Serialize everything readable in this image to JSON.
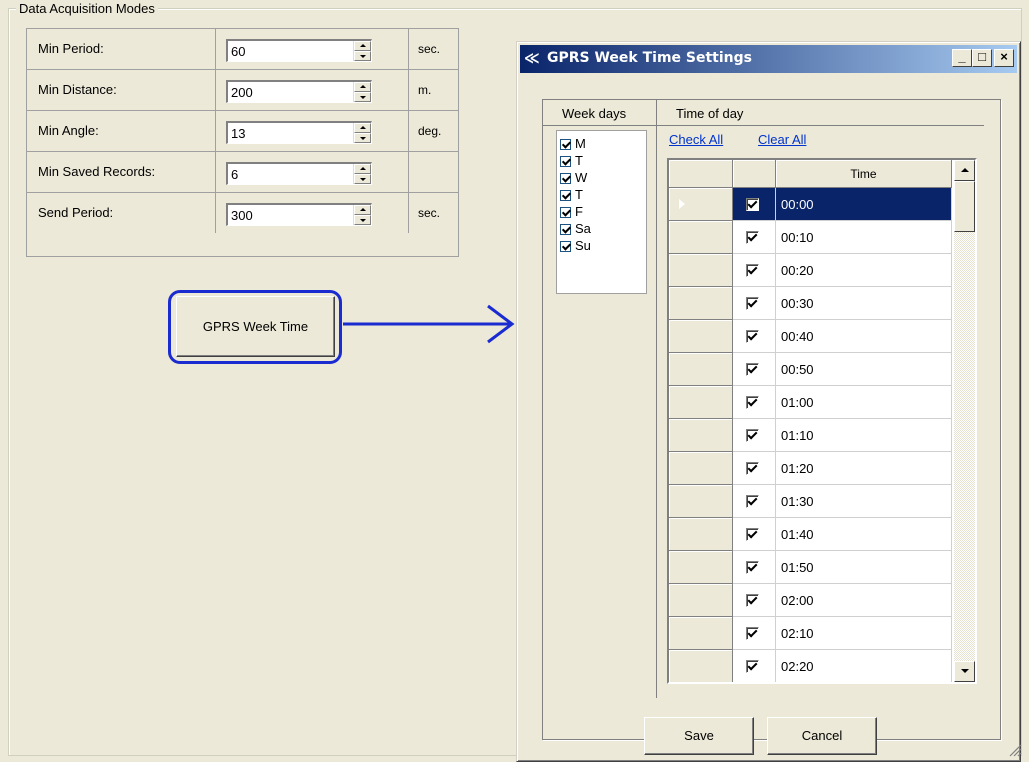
{
  "group": {
    "title": "Data Acquisition Modes"
  },
  "params": [
    {
      "label": "Min Period:",
      "value": "60",
      "unit": "sec."
    },
    {
      "label": "Min Distance:",
      "value": "200",
      "unit": "m."
    },
    {
      "label": "Min Angle:",
      "value": "13",
      "unit": "deg."
    },
    {
      "label": "Min Saved Records:",
      "value": "6",
      "unit": ""
    },
    {
      "label": "Send Period:",
      "value": "300",
      "unit": "sec."
    }
  ],
  "gprs_button": {
    "label": "GPRS Week Time"
  },
  "annotation": {
    "color": "#1a2bcf"
  },
  "dialog": {
    "title": "GPRS Week Time Settings",
    "icon": "app-icon",
    "titlebar_buttons": {
      "min": "_",
      "max": "□",
      "close": "×"
    },
    "weekdays": {
      "title": "Week days",
      "items": [
        {
          "label": "M",
          "checked": true
        },
        {
          "label": "T",
          "checked": true
        },
        {
          "label": "W",
          "checked": true
        },
        {
          "label": "T",
          "checked": true
        },
        {
          "label": "F",
          "checked": true
        },
        {
          "label": "Sa",
          "checked": true
        },
        {
          "label": "Su",
          "checked": true
        }
      ]
    },
    "timeofday": {
      "title": "Time of day",
      "check_all": "Check All",
      "clear_all": "Clear All",
      "column_header": "Time",
      "rows": [
        {
          "time": "00:00",
          "checked": true,
          "selected": true
        },
        {
          "time": "00:10",
          "checked": true
        },
        {
          "time": "00:20",
          "checked": true
        },
        {
          "time": "00:30",
          "checked": true
        },
        {
          "time": "00:40",
          "checked": true
        },
        {
          "time": "00:50",
          "checked": true
        },
        {
          "time": "01:00",
          "checked": true
        },
        {
          "time": "01:10",
          "checked": true
        },
        {
          "time": "01:20",
          "checked": true
        },
        {
          "time": "01:30",
          "checked": true
        },
        {
          "time": "01:40",
          "checked": true
        },
        {
          "time": "01:50",
          "checked": true
        },
        {
          "time": "02:00",
          "checked": true
        },
        {
          "time": "02:10",
          "checked": true
        },
        {
          "time": "02:20",
          "checked": true
        }
      ]
    },
    "save": "Save",
    "cancel": "Cancel"
  },
  "colors": {
    "selection": "#0a246a",
    "titlebar": "#0a246a",
    "link": "#0033cc"
  }
}
